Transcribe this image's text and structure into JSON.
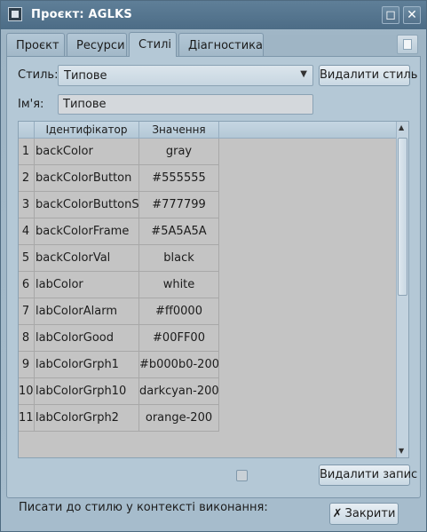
{
  "window": {
    "title": "Проєкт: AGLKS"
  },
  "tabs": [
    {
      "label": "Проєкт"
    },
    {
      "label": "Ресурси"
    },
    {
      "label": "Стилі"
    },
    {
      "label": "Діагностика"
    }
  ],
  "style_row": {
    "label": "Стиль:",
    "selected": "Типове",
    "delete_button": "Видалити стиль"
  },
  "name_row": {
    "label": "Ім'я:",
    "value": "Типове"
  },
  "table": {
    "headers": [
      "",
      "Ідентифікатор",
      "Значення"
    ],
    "rows": [
      {
        "num": "1",
        "id": "backColor",
        "value": "gray"
      },
      {
        "num": "2",
        "id": "backColorButton",
        "value": "#555555"
      },
      {
        "num": "3",
        "id": "backColorButtonSel",
        "value": "#777799"
      },
      {
        "num": "4",
        "id": "backColorFrame",
        "value": "#5A5A5A"
      },
      {
        "num": "5",
        "id": "backColorVal",
        "value": "black"
      },
      {
        "num": "6",
        "id": "labColor",
        "value": "white"
      },
      {
        "num": "7",
        "id": "labColorAlarm",
        "value": "#ff0000"
      },
      {
        "num": "8",
        "id": "labColorGood",
        "value": "#00FF00"
      },
      {
        "num": "9",
        "id": "labColorGrph1",
        "value": "#b000b0-200"
      },
      {
        "num": "10",
        "id": "labColorGrph10",
        "value": "darkcyan-200"
      },
      {
        "num": "11",
        "id": "labColorGrph2",
        "value": "orange-200"
      }
    ]
  },
  "delete_record_button": "Видалити запис",
  "runtime_checkbox": {
    "label": "Писати до стилю у контексті виконання:",
    "checked": false
  },
  "close_button": "Закрити",
  "colors": {
    "titlebar": "#4c6c86",
    "panel": "#b4c8d6",
    "table_bg": "#c4c4c4"
  }
}
